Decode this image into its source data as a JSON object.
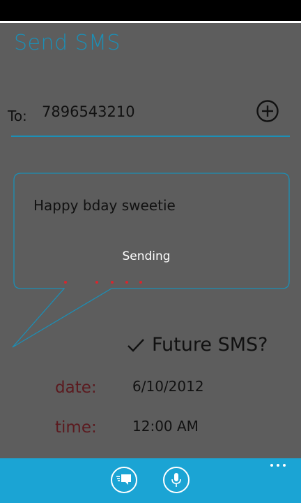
{
  "header": {
    "title": "Send SMS"
  },
  "to": {
    "label": "To:",
    "value": "7896543210"
  },
  "message": {
    "text": "Happy bday sweetie",
    "status": "Sending"
  },
  "future": {
    "label": "Future SMS?",
    "checked": true
  },
  "schedule": {
    "date_label": "date:",
    "date_value": "6/10/2012",
    "time_label": "time:",
    "time_value": "12:00 AM"
  },
  "colors": {
    "accent": "#1b8fb6",
    "app_bar": "#1ba4d4",
    "label": "#5b1a1f",
    "progress_dot": "#d8262e"
  },
  "icons": [
    "add-icon",
    "check-icon",
    "send-icon",
    "microphone-icon",
    "more-icon"
  ]
}
